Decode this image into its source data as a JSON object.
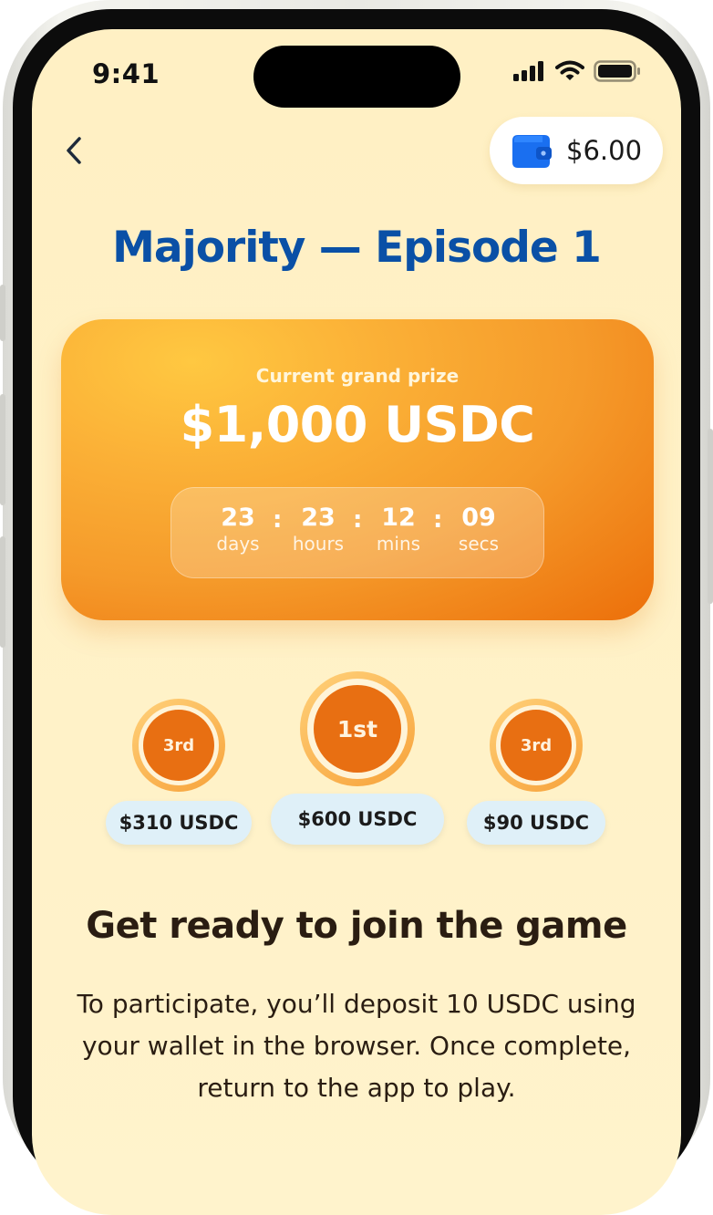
{
  "status_bar": {
    "time": "9:41"
  },
  "header": {
    "wallet_balance": "$6.00"
  },
  "episode": {
    "title": "Majority — Episode 1"
  },
  "prize_card": {
    "label": "Current grand prize",
    "amount": "$1,000 USDC",
    "countdown": [
      {
        "value": "23",
        "label": "days"
      },
      {
        "value": "23",
        "label": "hours"
      },
      {
        "value": "12",
        "label": "mins"
      },
      {
        "value": "09",
        "label": "secs"
      }
    ],
    "separator": ":"
  },
  "podium": [
    {
      "rank": "3rd",
      "prize": "$310 USDC"
    },
    {
      "rank": "1st",
      "prize": "$600 USDC"
    },
    {
      "rank": "3rd",
      "prize": "$90 USDC"
    }
  ],
  "join": {
    "heading": "Get ready to join the game",
    "body": "To participate, you’ll deposit 10 USDC using your wallet in the browser. Once complete, return to the app to play."
  },
  "colors": {
    "title_blue": "#0a50a6",
    "accent_orange": "#e86f12",
    "background_cream": "#fff0c4",
    "pill_blue": "#dff0f8"
  }
}
